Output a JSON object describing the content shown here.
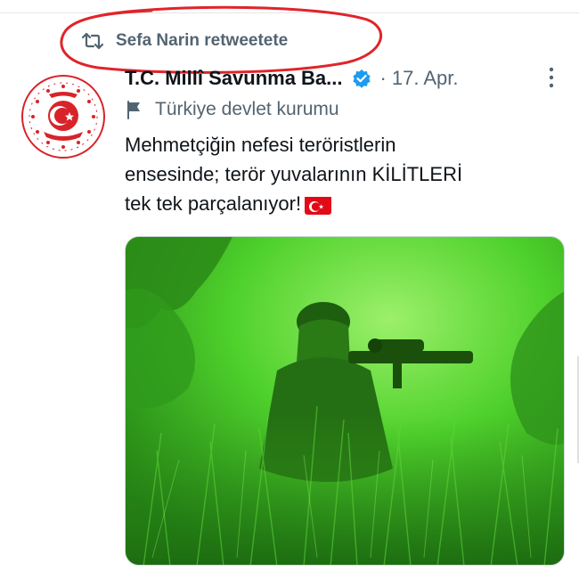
{
  "retweet": {
    "icon": "retweet-icon",
    "text": "Sefa Narin retweetete",
    "highlight_color": "#e0242a"
  },
  "author": {
    "avatar_icon": "tc-msb-emblem",
    "name": "T.C. Millî Savunma Ba...",
    "verified_icon": "verified-badge-icon",
    "separator": "·",
    "date": "17. Apr.",
    "label_icon": "flag-icon",
    "label": "Türkiye devlet kurumu"
  },
  "tweet": {
    "lines": [
      "Mehmetçiğin nefesi teröristlerin",
      "ensesinde; terör yuvalarının KİLİTLERİ",
      "tek tek parçalanıyor!"
    ],
    "emoji": "turkey-flag"
  },
  "media": {
    "description": "night-vision-soldier-photo",
    "tint": "#3fbf2a"
  },
  "colors": {
    "muted": "#536471",
    "text": "#0f1419",
    "verified": "#1d9bf0",
    "emblem_red": "#d8232a"
  }
}
